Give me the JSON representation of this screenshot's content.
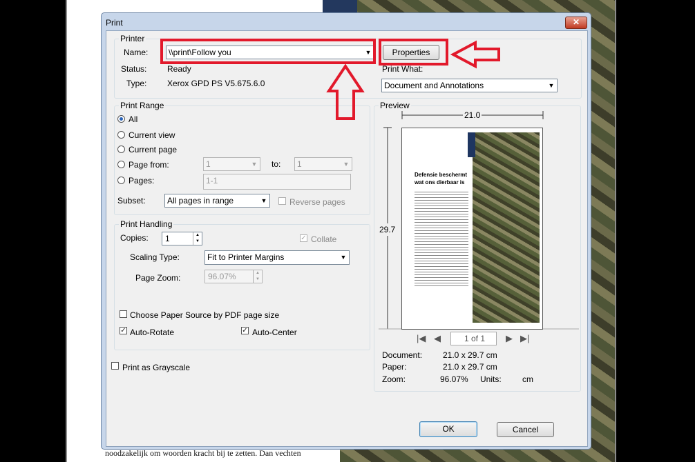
{
  "background": {
    "doc_text": "noodzakelijk om woorden kracht bij te zetten. Dan vechten"
  },
  "dialog": {
    "title": "Print",
    "close_glyph": "✕"
  },
  "printer": {
    "group_label": "Printer",
    "name_label": "Name:",
    "name_value": "\\\\print\\Follow you",
    "status_label": "Status:",
    "status_value": "Ready",
    "type_label": "Type:",
    "type_value": "Xerox GPD PS V5.675.6.0",
    "properties_label": "Properties",
    "print_what_label": "Print What:",
    "print_what_value": "Document and Annotations"
  },
  "range": {
    "group_label": "Print Range",
    "all": "All",
    "current_view": "Current view",
    "current_page": "Current page",
    "page_from": "Page from:",
    "page_from_value": "1",
    "to_label": "to:",
    "to_value": "1",
    "pages": "Pages:",
    "pages_value": "1-1",
    "subset_label": "Subset:",
    "subset_value": "All pages in range",
    "reverse_pages": "Reverse pages"
  },
  "handling": {
    "group_label": "Print Handling",
    "copies_label": "Copies:",
    "copies_value": "1",
    "collate": "Collate",
    "scaling_label": "Scaling Type:",
    "scaling_value": "Fit to Printer Margins",
    "zoom_label": "Page Zoom:",
    "zoom_value": "96.07%",
    "paper_source": "Choose Paper Source by PDF page size",
    "auto_rotate": "Auto-Rotate",
    "auto_center": "Auto-Center"
  },
  "grayscale": "Print as Grayscale",
  "preview": {
    "group_label": "Preview",
    "width_value": "21.0",
    "height_value": "29.7",
    "page_title_line1": "Defensie beschermt",
    "page_title_line2": "wat ons dierbaar is",
    "page_indicator": "1 of 1",
    "document_label": "Document:",
    "document_value": "21.0 x 29.7 cm",
    "paper_label": "Paper:",
    "paper_value": "21.0 x 29.7 cm",
    "zoom_label": "Zoom:",
    "zoom_value": "96.07%",
    "units_label": "Units:",
    "units_value": "cm"
  },
  "buttons": {
    "ok": "OK",
    "cancel": "Cancel"
  },
  "colors": {
    "annotation": "#e2192b",
    "dialog_frame": "#c7d6ea"
  }
}
